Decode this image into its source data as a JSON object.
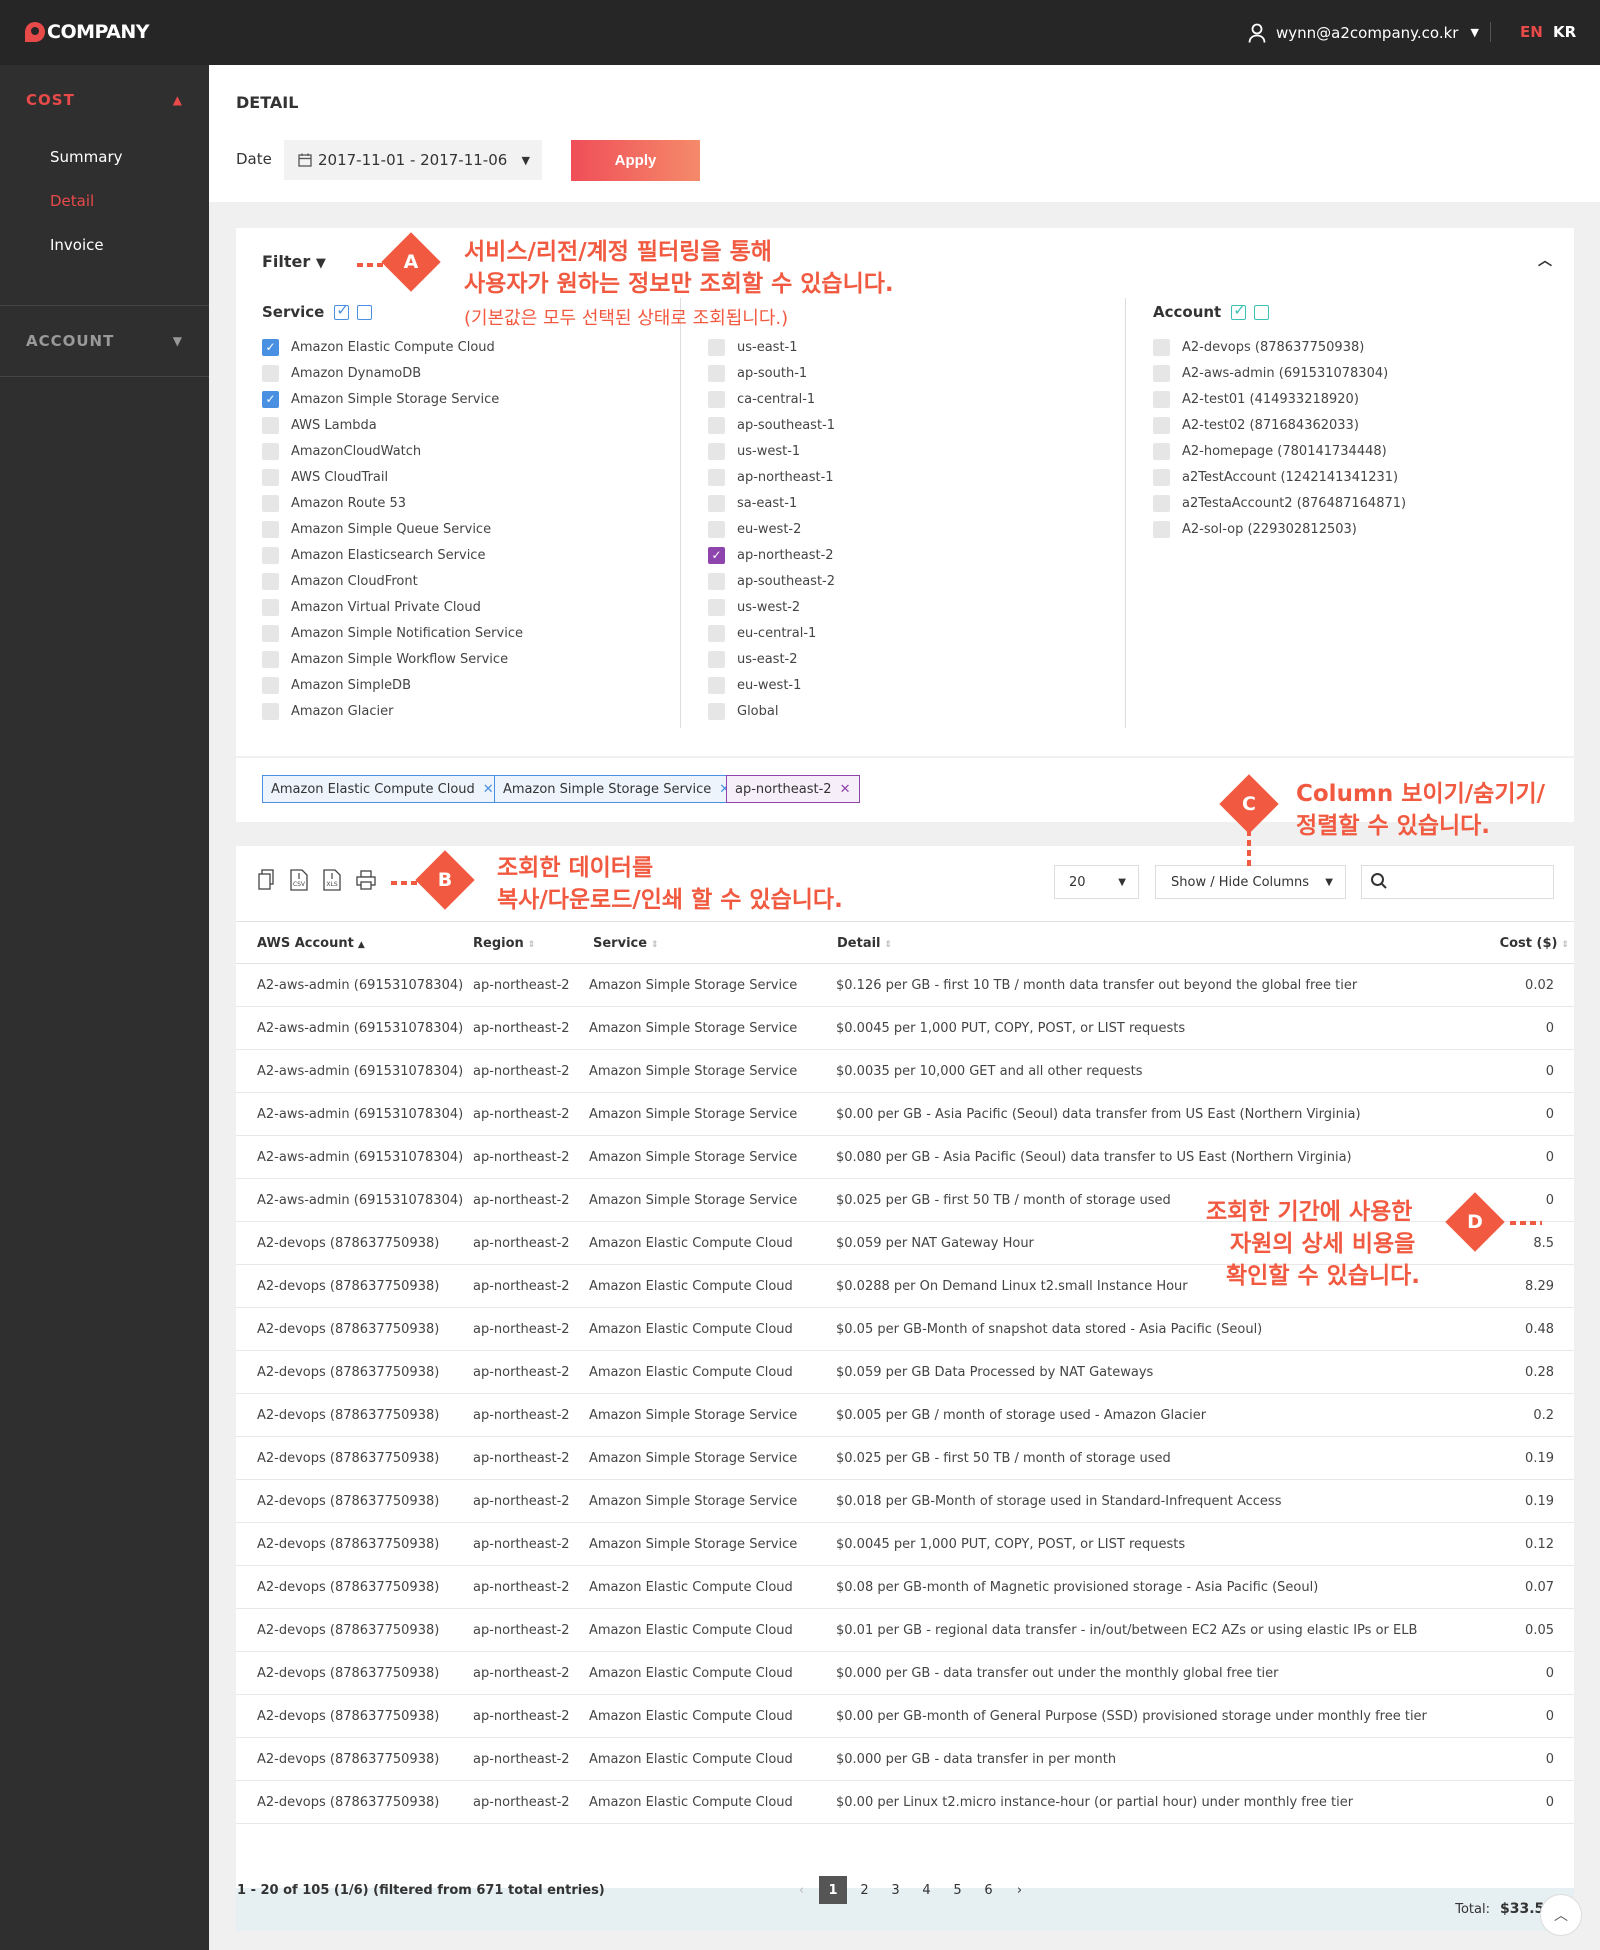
{
  "app": {
    "brand": "COMPANY"
  },
  "header": {
    "user_email": "wynn@a2company.co.kr",
    "lang_en": "EN",
    "lang_kr": "KR"
  },
  "sidebar": {
    "cost_label": "COST",
    "items": [
      {
        "label": "Summary",
        "active": false
      },
      {
        "label": "Detail",
        "active": true
      },
      {
        "label": "Invoice",
        "active": false
      }
    ],
    "account_label": "ACCOUNT"
  },
  "page": {
    "title": "DETAIL",
    "date_label": "Date",
    "date_range": "2017-11-01 - 2017-11-06",
    "apply_label": "Apply"
  },
  "filter": {
    "title": "Filter",
    "service_label": "Service",
    "account_label": "Account",
    "services": [
      {
        "label": "Amazon Elastic Compute Cloud",
        "checked": true
      },
      {
        "label": "Amazon DynamoDB",
        "checked": false
      },
      {
        "label": "Amazon Simple Storage Service",
        "checked": true
      },
      {
        "label": "AWS Lambda",
        "checked": false
      },
      {
        "label": "AmazonCloudWatch",
        "checked": false
      },
      {
        "label": "AWS CloudTrail",
        "checked": false
      },
      {
        "label": "Amazon Route 53",
        "checked": false
      },
      {
        "label": "Amazon Simple Queue Service",
        "checked": false
      },
      {
        "label": "Amazon Elasticsearch Service",
        "checked": false
      },
      {
        "label": "Amazon CloudFront",
        "checked": false
      },
      {
        "label": "Amazon Virtual Private Cloud",
        "checked": false
      },
      {
        "label": "Amazon Simple Notification Service",
        "checked": false
      },
      {
        "label": "Amazon Simple Workflow Service",
        "checked": false
      },
      {
        "label": "Amazon SimpleDB",
        "checked": false
      },
      {
        "label": "Amazon Glacier",
        "checked": false
      }
    ],
    "regions": [
      {
        "label": "us-east-1",
        "checked": false
      },
      {
        "label": "ap-south-1",
        "checked": false
      },
      {
        "label": "ca-central-1",
        "checked": false
      },
      {
        "label": "ap-southeast-1",
        "checked": false
      },
      {
        "label": "us-west-1",
        "checked": false
      },
      {
        "label": "ap-northeast-1",
        "checked": false
      },
      {
        "label": "sa-east-1",
        "checked": false
      },
      {
        "label": "eu-west-2",
        "checked": false
      },
      {
        "label": "ap-northeast-2",
        "checked": true
      },
      {
        "label": "ap-southeast-2",
        "checked": false
      },
      {
        "label": "us-west-2",
        "checked": false
      },
      {
        "label": "eu-central-1",
        "checked": false
      },
      {
        "label": "us-east-2",
        "checked": false
      },
      {
        "label": "eu-west-1",
        "checked": false
      },
      {
        "label": "Global",
        "checked": false
      }
    ],
    "accounts": [
      {
        "label": "A2-devops (878637750938)",
        "checked": false
      },
      {
        "label": "A2-aws-admin (691531078304)",
        "checked": false
      },
      {
        "label": "A2-test01 (414933218920)",
        "checked": false
      },
      {
        "label": "A2-test02 (871684362033)",
        "checked": false
      },
      {
        "label": "A2-homepage (780141734448)",
        "checked": false
      },
      {
        "label": "a2TestAccount (1242141341231)",
        "checked": false
      },
      {
        "label": "a2TestaAccount2 (876487164871)",
        "checked": false
      },
      {
        "label": "A2-sol-op (229302812503)",
        "checked": false
      }
    ],
    "tags": [
      {
        "label": "Amazon Elastic Compute Cloud",
        "kind": "service"
      },
      {
        "label": "Amazon Simple Storage Service",
        "kind": "service"
      },
      {
        "label": "ap-northeast-2",
        "kind": "region"
      }
    ]
  },
  "table": {
    "page_size": "20",
    "columns_button": "Show / Hide Columns",
    "columns": [
      "AWS Account",
      "Region",
      "Service",
      "Detail",
      "Cost ($)"
    ],
    "rows": [
      [
        "A2-aws-admin (691531078304)",
        "ap-northeast-2",
        "Amazon Simple Storage Service",
        "$0.126 per GB - first 10 TB / month data transfer out beyond the global free tier",
        "0.02"
      ],
      [
        "A2-aws-admin (691531078304)",
        "ap-northeast-2",
        "Amazon Simple Storage Service",
        "$0.0045 per 1,000 PUT, COPY, POST, or LIST requests",
        "0"
      ],
      [
        "A2-aws-admin (691531078304)",
        "ap-northeast-2",
        "Amazon Simple Storage Service",
        "$0.0035 per 10,000 GET and all other requests",
        "0"
      ],
      [
        "A2-aws-admin (691531078304)",
        "ap-northeast-2",
        "Amazon Simple Storage Service",
        "$0.00 per GB - Asia Pacific (Seoul) data transfer from US East (Northern Virginia)",
        "0"
      ],
      [
        "A2-aws-admin (691531078304)",
        "ap-northeast-2",
        "Amazon Simple Storage Service",
        "$0.080 per GB - Asia Pacific (Seoul) data transfer to US East (Northern Virginia)",
        "0"
      ],
      [
        "A2-aws-admin (691531078304)",
        "ap-northeast-2",
        "Amazon Simple Storage Service",
        "$0.025 per GB - first 50 TB / month of storage used",
        "0"
      ],
      [
        "A2-devops (878637750938)",
        "ap-northeast-2",
        "Amazon Elastic Compute Cloud",
        "$0.059 per NAT Gateway Hour",
        "8.5"
      ],
      [
        "A2-devops (878637750938)",
        "ap-northeast-2",
        "Amazon Elastic Compute Cloud",
        "$0.0288 per On Demand Linux t2.small Instance Hour",
        "8.29"
      ],
      [
        "A2-devops (878637750938)",
        "ap-northeast-2",
        "Amazon Elastic Compute Cloud",
        "$0.05 per GB-Month of snapshot data stored - Asia Pacific (Seoul)",
        "0.48"
      ],
      [
        "A2-devops (878637750938)",
        "ap-northeast-2",
        "Amazon Elastic Compute Cloud",
        "$0.059 per GB Data Processed by NAT Gateways",
        "0.28"
      ],
      [
        "A2-devops (878637750938)",
        "ap-northeast-2",
        "Amazon Simple Storage Service",
        "$0.005 per GB / month of storage used - Amazon Glacier",
        "0.2"
      ],
      [
        "A2-devops (878637750938)",
        "ap-northeast-2",
        "Amazon Simple Storage Service",
        "$0.025 per GB - first 50 TB / month of storage used",
        "0.19"
      ],
      [
        "A2-devops (878637750938)",
        "ap-northeast-2",
        "Amazon Simple Storage Service",
        "$0.018 per GB-Month of storage used in Standard-Infrequent Access",
        "0.19"
      ],
      [
        "A2-devops (878637750938)",
        "ap-northeast-2",
        "Amazon Simple Storage Service",
        "$0.0045 per 1,000 PUT, COPY, POST, or LIST requests",
        "0.12"
      ],
      [
        "A2-devops (878637750938)",
        "ap-northeast-2",
        "Amazon Elastic Compute Cloud",
        "$0.08 per GB-month of Magnetic provisioned storage - Asia Pacific (Seoul)",
        "0.07"
      ],
      [
        "A2-devops (878637750938)",
        "ap-northeast-2",
        "Amazon Elastic Compute Cloud",
        "$0.01 per GB - regional data transfer - in/out/between EC2 AZs or using elastic IPs or ELB",
        "0.05"
      ],
      [
        "A2-devops (878637750938)",
        "ap-northeast-2",
        "Amazon Elastic Compute Cloud",
        "$0.000 per GB - data transfer out under the monthly global free tier",
        "0"
      ],
      [
        "A2-devops (878637750938)",
        "ap-northeast-2",
        "Amazon Elastic Compute Cloud",
        "$0.00 per GB-month of General Purpose (SSD) provisioned storage under monthly free tier",
        "0"
      ],
      [
        "A2-devops (878637750938)",
        "ap-northeast-2",
        "Amazon Elastic Compute Cloud",
        "$0.000 per GB - data transfer in per month",
        "0"
      ],
      [
        "A2-devops (878637750938)",
        "ap-northeast-2",
        "Amazon Elastic Compute Cloud",
        "$0.00 per Linux t2.micro instance-hour (or partial hour) under monthly free tier",
        "0"
      ]
    ],
    "total_label": "Total:",
    "total_value": "$33.56",
    "pager_info": "1 - 20 of 105 (1/6) (filtered from 671 total entries)",
    "pages": [
      "1",
      "2",
      "3",
      "4",
      "5",
      "6"
    ]
  },
  "annotations": {
    "a_badge": "A",
    "a_line1": "서비스/리전/계정 필터링을 통해",
    "a_line2": "사용자가 원하는 정보만 조회할 수 있습니다.",
    "a_line3": "(기본값은 모두 선택된 상태로 조회됩니다.)",
    "b_badge": "B",
    "b_line1": "조회한 데이터를",
    "b_line2": "복사/다운로드/인쇄 할 수 있습니다.",
    "c_badge": "C",
    "c_line1": "Column 보이기/숨기기/",
    "c_line2": "정렬할 수 있습니다.",
    "d_badge": "D",
    "d_line1": "조회한 기간에 사용한",
    "d_line2": "자원의 상세 비용을",
    "d_line3": "확인할 수 있습니다."
  },
  "colors": {
    "accent": "#f15a40",
    "brand_red": "#e84a4a",
    "checkbox_blue": "#4a90e2",
    "checkbox_purple": "#8e44ad",
    "sidebar": "#2f2f2f",
    "topbar": "#262626"
  }
}
